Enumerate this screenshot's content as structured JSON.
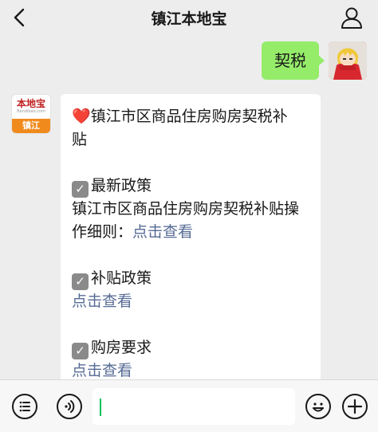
{
  "nav": {
    "title": "镇江本地宝",
    "back_icon": "chevron-left-icon",
    "profile_icon": "user-icon"
  },
  "messages": {
    "sent": {
      "text": "契税"
    },
    "bot": {
      "avatar_logo": "本地宝",
      "avatar_url": "Bendibao.com",
      "avatar_city": "镇江",
      "lines": [
        "镇江市区商品住房购房契税补",
        "贴"
      ],
      "section1_title": "最新政策",
      "section1_line1": "镇江市区商品住房购房契税补贴操",
      "section1_line2_prefix": "作细则：",
      "section1_link": "点击查看",
      "section2_title": "补贴政策",
      "section2_link": "点击查看",
      "section3_title": "购房要求",
      "section3_link": "点击查看"
    }
  },
  "input_bar": {
    "menu_icon": "list-menu-icon",
    "voice_icon": "voice-icon",
    "emoji_icon": "emoji-icon",
    "plus_icon": "plus-icon",
    "value": ""
  },
  "colors": {
    "sent_bubble": "#95ec69",
    "link": "#576b95",
    "background": "#ededed"
  }
}
